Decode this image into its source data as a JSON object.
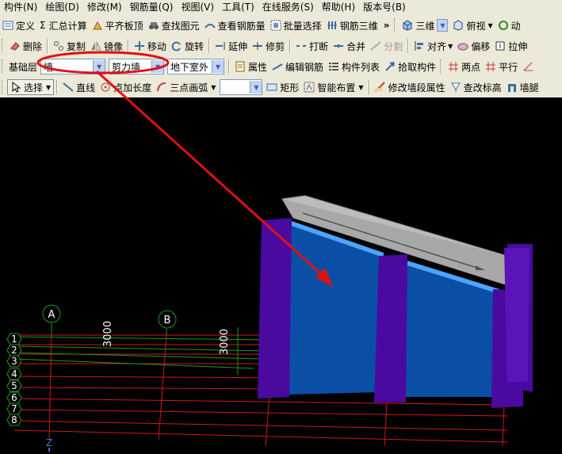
{
  "menu": [
    "构件(N)",
    "绘图(D)",
    "修改(M)",
    "钢筋量(Q)",
    "视图(V)",
    "工具(T)",
    "在线服务(S)",
    "帮助(H)",
    "版本号(B)"
  ],
  "toolbar1": {
    "define": "定义",
    "sum_calc": "汇总计算",
    "sum_icon": "Σ",
    "level_top": "平齐板顶",
    "find": "查找图元",
    "view_rebar": "查看钢筋量",
    "batch_select": "批量选择",
    "rebar_3d": "钢筋三维",
    "more": "»",
    "view3d": "三维",
    "top_view": "俯视",
    "dyn": "动"
  },
  "toolbar2": {
    "delete": "删除",
    "copy": "复制",
    "mirror": "镜像",
    "move": "移动",
    "rotate": "旋转",
    "extend": "延伸",
    "trim": "修剪",
    "break": "打断",
    "merge": "合并",
    "split": "分割",
    "align": "对齐",
    "offset": "偏移",
    "stretch": "拉伸"
  },
  "toolbar3": {
    "floor": "基础层",
    "type": "墙",
    "subtype": "剪力墙",
    "name": "地下室外",
    "props": "属性",
    "edit_rebar": "编辑钢筋",
    "comp_list": "构件列表",
    "pick": "拾取构件",
    "two_point": "两点",
    "parallel": "平行"
  },
  "toolbar4": {
    "select": "选择",
    "line": "直线",
    "point_len": "点加长度",
    "arc3": "三点画弧",
    "rect": "矩形",
    "smart": "智能布置",
    "modify_seg": "修改墙段属性",
    "modify_elev": "查改标高",
    "wall": "墙腿"
  },
  "viewport": {
    "axis_cols": [
      "A",
      "B"
    ],
    "axis_rows": [
      "1",
      "2",
      "3",
      "4",
      "5",
      "6",
      "7",
      "8"
    ],
    "dims": [
      "3000",
      "3000"
    ],
    "z_label": "Z"
  },
  "colors": {
    "wall_blue": "#0a4fa5",
    "column_purple": "#4a0aa0",
    "grid_red": "#d01818",
    "grid_green": "#1a9a1a",
    "slab_gray": "#b4b4b4",
    "annotation_red": "#e01010"
  }
}
